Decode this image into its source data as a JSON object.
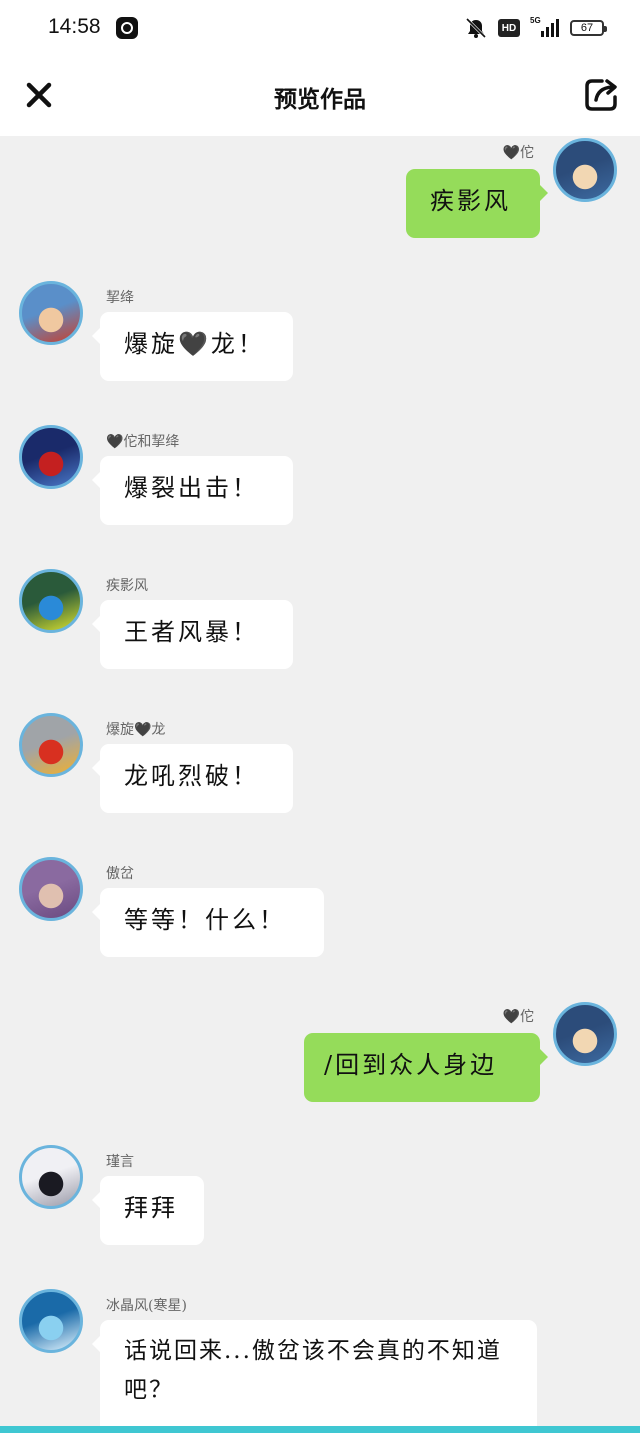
{
  "status_bar": {
    "time": "14:58",
    "app_badge_icon": "app-notification-icon",
    "mute_icon": "bell-muted-icon",
    "hd_label": "HD",
    "network_label": "5G",
    "battery_level": "67"
  },
  "header": {
    "title": "预览作品",
    "close_icon": "close-icon",
    "share_icon": "share-icon"
  },
  "messages": [
    {
      "side": "sent",
      "sender": "🖤佗",
      "text": "疾影风",
      "avatar_colors": [
        "#2c4c7a",
        "#f2d7b3",
        "#3d6aa0"
      ]
    },
    {
      "side": "recv",
      "sender": "挈绛",
      "text": "爆旋🖤龙！",
      "avatar_colors": [
        "#5a8fc9",
        "#f0c8a0",
        "#c8402e"
      ]
    },
    {
      "side": "recv",
      "sender": "🖤佗和挈绛",
      "text": "爆裂出击！",
      "avatar_colors": [
        "#1a2a6a",
        "#c42020",
        "#4a78c8"
      ]
    },
    {
      "side": "recv",
      "sender": "疾影风",
      "text": "王者风暴！",
      "avatar_colors": [
        "#2a5a3a",
        "#2a8ad8",
        "#d8e030"
      ]
    },
    {
      "side": "recv",
      "sender": "爆旋🖤龙",
      "text": "龙吼烈破！",
      "avatar_colors": [
        "#a0a4a8",
        "#d83020",
        "#f0b030"
      ]
    },
    {
      "side": "recv",
      "sender": "傲岔",
      "text": "等等！什么！",
      "avatar_colors": [
        "#8a6aa0",
        "#e0c0b0",
        "#6a4a80"
      ]
    },
    {
      "side": "sent",
      "sender": "🖤佗",
      "text": "/回到众人身边",
      "avatar_colors": [
        "#2c4c7a",
        "#f2d7b3",
        "#3d6aa0"
      ]
    },
    {
      "side": "recv",
      "sender": "瑾言",
      "text": "拜拜",
      "avatar_colors": [
        "#f0f0f4",
        "#1a1a22",
        "#9a9aa8"
      ]
    },
    {
      "side": "recv",
      "sender": "冰晶风(寒星)",
      "text": "话说回来...傲岔该不会真的不知道吧？",
      "avatar_colors": [
        "#1a6aa8",
        "#8ad0f0",
        "#e0f4ff"
      ]
    }
  ],
  "colors": {
    "sent_bubble": "#95dc5a",
    "received_bubble": "#ffffff",
    "avatar_ring": "#6ab4dd",
    "background": "#f0f0f0",
    "bottom_strip": "#3fc7d2"
  }
}
